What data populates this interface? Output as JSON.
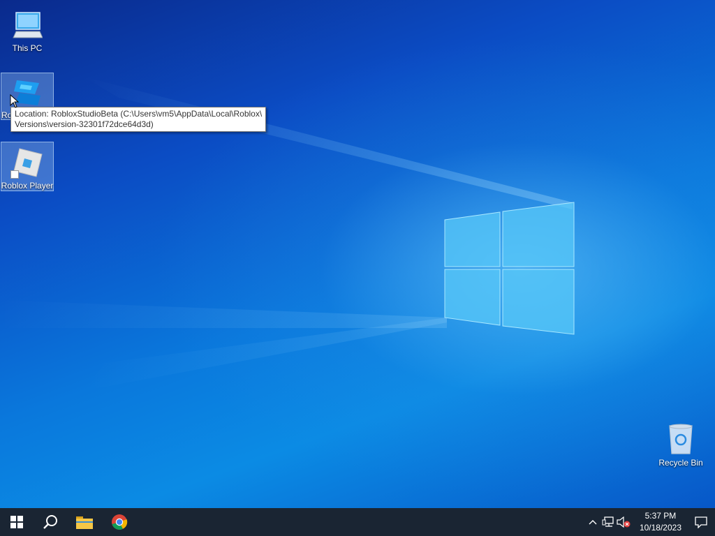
{
  "desktop": {
    "icons": [
      {
        "label": "This PC"
      },
      {
        "label": "Ro"
      },
      {
        "label": "Roblox Player"
      },
      {
        "label": "Recycle Bin"
      }
    ]
  },
  "tooltip": {
    "line1": "Location: RobloxStudioBeta (C:\\Users\\vm5\\AppData\\Local\\Roblox\\",
    "line2": "Versions\\version-32301f72dce64d3d)"
  },
  "taskbar": {
    "start": "start-icon",
    "search": "search-icon",
    "pinned": [
      "file-explorer-icon",
      "chrome-icon"
    ],
    "clock": {
      "time": "5:37 PM",
      "date": "10/18/2023"
    }
  },
  "colors": {
    "taskbar": "#1a2533",
    "desktop_accent": "#0a78dc"
  }
}
